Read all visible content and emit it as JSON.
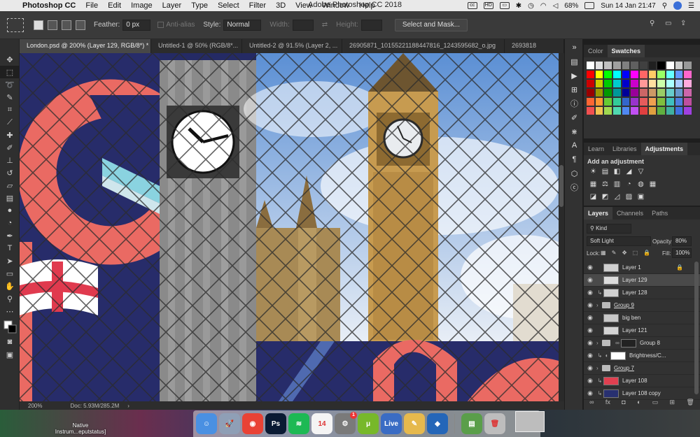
{
  "menubar": {
    "app_name": "Photoshop CC",
    "menus": [
      "File",
      "Edit",
      "Image",
      "Layer",
      "Type",
      "Select",
      "Filter",
      "3D",
      "View",
      "Window",
      "Help"
    ],
    "window_title": "Adobe Photoshop CC 2018",
    "battery": "68%",
    "date_time": "Sun 14 Jan  21:47"
  },
  "options": {
    "feather_label": "Feather:",
    "feather_value": "0 px",
    "anti_alias": "Anti-alias",
    "style_label": "Style:",
    "style_value": "Normal",
    "width_label": "Width:",
    "height_label": "Height:",
    "select_mask": "Select and Mask..."
  },
  "tabs": [
    "London.psd @ 200% (Layer 129, RGB/8*) *",
    "Untitled-1 @ 50% (RGB/8*...",
    "Untitled-2 @ 91.5% (Layer 2, ...",
    "26905871_10155221188447816_1243595682_o.jpg",
    "2693818"
  ],
  "status": {
    "zoom": "200%",
    "doc": "Doc: 5.93M/285.2M"
  },
  "swatches_panel": {
    "tabs": [
      "Color",
      "Swatches"
    ],
    "colors": [
      [
        "#ffffff",
        "#e0e0e0",
        "#c0c0c0",
        "#a0a0a0",
        "#808080",
        "#606060",
        "#404040",
        "#202020",
        "#000000",
        "#ffffff",
        "#cccccc",
        "#999999"
      ],
      [
        "#ff0000",
        "#ffff00",
        "#00ff00",
        "#00ffff",
        "#0000ff",
        "#ff00ff",
        "#ff6666",
        "#ffcc66",
        "#99ff66",
        "#66ffff",
        "#6699ff",
        "#ff66cc"
      ],
      [
        "#cc0000",
        "#cccc00",
        "#00cc00",
        "#00cccc",
        "#0000cc",
        "#cc00cc",
        "#ff9999",
        "#ffe0a0",
        "#ccffaa",
        "#aaffff",
        "#aaccff",
        "#ffaadd"
      ],
      [
        "#990000",
        "#999900",
        "#009900",
        "#009999",
        "#000099",
        "#990099",
        "#cc6666",
        "#cc9966",
        "#99cc66",
        "#66cccc",
        "#6699cc",
        "#cc66aa"
      ],
      [
        "#ff6633",
        "#ff9933",
        "#66cc33",
        "#33cc99",
        "#3366cc",
        "#9933cc",
        "#e65c5c",
        "#f0a050",
        "#7fbf3f",
        "#3fbfbf",
        "#4f7fdf",
        "#bf4f9f"
      ],
      [
        "#f25050",
        "#f2c250",
        "#a0d850",
        "#50d8b0",
        "#5088f2",
        "#c050f2",
        "#e04040",
        "#e0a040",
        "#60b040",
        "#40b0a0",
        "#4070e0",
        "#a040e0"
      ]
    ]
  },
  "adjust_panel": {
    "tabs": [
      "Learn",
      "Libraries",
      "Adjustments"
    ],
    "title": "Add an adjustment",
    "row1": [
      "☀",
      "▤",
      "◧",
      "◢",
      "▽"
    ],
    "row2": [
      "▦",
      "⚖",
      "▥",
      "◔",
      "◍",
      "▦"
    ],
    "row3": [
      "◪",
      "◩",
      "◿",
      "▨",
      "▣"
    ]
  },
  "layers_panel": {
    "tabs": [
      "Layers",
      "Channels",
      "Paths"
    ],
    "filter": "Kind",
    "blend_mode": "Soft Light",
    "opacity_label": "Opacity:",
    "opacity_value": "80%",
    "lock_label": "Lock:",
    "fill_label": "Fill:",
    "fill_value": "100%",
    "layers": [
      {
        "name": "Layer 1",
        "type": "layer",
        "thumb": "#cfcfcf",
        "locked": true
      },
      {
        "name": "Layer 129",
        "type": "layer",
        "thumb": "#dcdcdc",
        "selected": true
      },
      {
        "name": "Layer 128",
        "type": "clip",
        "thumb": "#d0d0d0"
      },
      {
        "name": "Group 9",
        "type": "group"
      },
      {
        "name": "big ben",
        "type": "layer",
        "thumb": "#c8c8c8"
      },
      {
        "name": "Layer 121",
        "type": "layer",
        "thumb": "#d4d4d4"
      },
      {
        "name": "Group 8",
        "type": "group-mask",
        "thumb": "#222222"
      },
      {
        "name": "Brightness/C...",
        "type": "adjust",
        "thumb": "#ffffff"
      },
      {
        "name": "Group 7",
        "type": "group"
      },
      {
        "name": "Layer 108",
        "type": "clip",
        "thumb": "#e04050"
      },
      {
        "name": "Layer 108 copy",
        "type": "clip",
        "thumb": "#283070"
      }
    ],
    "footer": [
      "∞",
      "fx",
      "◘",
      "◐",
      "▭",
      "⊞",
      "🗑"
    ]
  },
  "dock": {
    "desktop_label": "Native Instrum...eputstatus]",
    "apps": [
      {
        "name": "finder",
        "label": "☺",
        "bg": "#4a90e2"
      },
      {
        "name": "launchpad",
        "label": "🚀",
        "bg": "#8f9fb6"
      },
      {
        "name": "chrome",
        "label": "◉",
        "bg": "#e94235"
      },
      {
        "name": "photoshop",
        "label": "Ps",
        "bg": "#0a1a33"
      },
      {
        "name": "spotify",
        "label": "≋",
        "bg": "#1db954"
      },
      {
        "name": "calendar",
        "label": "14",
        "bg": "#f4f4f4"
      },
      {
        "name": "system-preferences",
        "label": "⚙",
        "bg": "#7a7a7a",
        "badge": "1"
      },
      {
        "name": "utorrent",
        "label": "μ",
        "bg": "#77b82a"
      },
      {
        "name": "live",
        "label": "Live",
        "bg": "#3a6cc4"
      },
      {
        "name": "textedit",
        "label": "✎",
        "bg": "#e6b94d"
      },
      {
        "name": "virtualbox",
        "label": "◆",
        "bg": "#2466b8"
      },
      {
        "name": "finder-2",
        "label": "▤",
        "bg": "#5a9e4a"
      },
      {
        "name": "trash",
        "label": "🗑",
        "bg": "#bdbdbd"
      }
    ]
  }
}
